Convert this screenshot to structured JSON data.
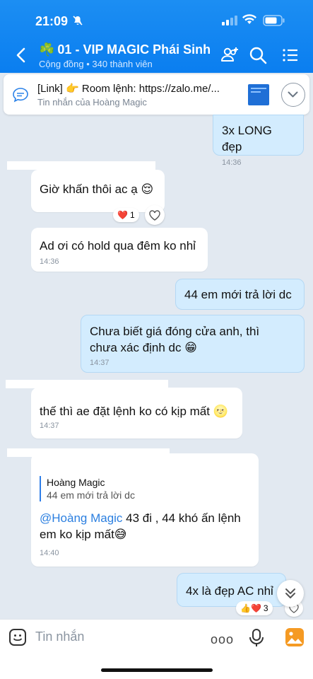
{
  "status_bar": {
    "time": "21:09"
  },
  "header": {
    "title": "01 - VIP MAGIC Phái Sinh",
    "title_icon": "☘️",
    "subtitle": "Cộng đồng • 340 thành viên"
  },
  "pinned": {
    "text": "[Link] 👉 Room lệnh: https://zalo.me/...",
    "sub": "Tin nhắn của Hoàng Magic"
  },
  "messages": [
    {
      "text": "3x LONG đẹp",
      "time": "14:36"
    },
    {
      "text": "Giờ khấn thôi ac ạ 😌",
      "reaction": "❤️",
      "reaction_count": "1"
    },
    {
      "text": "Ad ơi có hold qua đêm ko nhỉ",
      "time": "14:36"
    },
    {
      "text": "44 em mới trả lời dc"
    },
    {
      "text": "Chưa biết giá đóng cửa anh, thì chưa xác định dc 😁",
      "time": "14:37"
    },
    {
      "text": "thế thì ae đặt lệnh ko có kịp mất 🌝",
      "time": "14:37"
    },
    {
      "quote_name": "Hoàng Magic",
      "quote_text": "44 em mới trả lời dc",
      "mention": "@Hoàng Magic",
      "text": " 43 đi , 44 khó ấn lệnh em ko kịp mất😅",
      "time": "14:40"
    },
    {
      "text": "4x là đẹp AC nhỉ",
      "reaction": "👍❤️",
      "reaction_count": "3"
    }
  ],
  "composer": {
    "placeholder": "Tin nhắn",
    "more": "ooo"
  }
}
